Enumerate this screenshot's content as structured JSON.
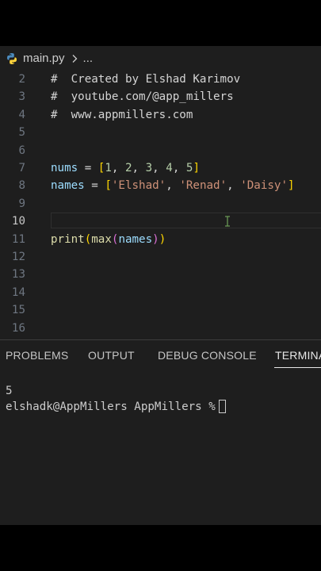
{
  "breadcrumb": {
    "filename": "main.py",
    "more": "..."
  },
  "editor": {
    "line_numbers": [
      "2",
      "3",
      "4",
      "5",
      "6",
      "7",
      "8",
      "9",
      "10",
      "11",
      "12",
      "13",
      "14",
      "15",
      "16"
    ],
    "active_line": "10",
    "lines": {
      "l2": {
        "hash": "#",
        "text": "  Created by Elshad Karimov"
      },
      "l3": {
        "hash": "#",
        "text": "  youtube.com/@app_millers"
      },
      "l4": {
        "hash": "#",
        "text": "  www.appmillers.com"
      },
      "l7": {
        "var": "nums",
        "eq": " = ",
        "open": "[",
        "n1": "1",
        "n2": "2",
        "n3": "3",
        "n4": "4",
        "n5": "5",
        "close": "]",
        "sep": ", "
      },
      "l8": {
        "var": "names",
        "eq": " = ",
        "open": "[",
        "s1": "'Elshad'",
        "s2": "'Renad'",
        "s3": "'Daisy'",
        "close": "]",
        "sep": ", "
      },
      "l11": {
        "print": "print",
        "open1": "(",
        "max": "max",
        "open2": "(",
        "arg": "names",
        "close2": ")",
        "close1": ")"
      }
    }
  },
  "panel": {
    "tabs": [
      "PROBLEMS",
      "OUTPUT",
      "DEBUG CONSOLE",
      "TERMINAL"
    ],
    "active_tab": "TERMINAL",
    "terminal": {
      "output": "5",
      "prompt": "elshadk@AppMillers AppMillers %"
    }
  },
  "colors": {
    "background": "#1e1e1e",
    "comment": "#6a9955",
    "variable": "#9cdcfe",
    "number": "#b5cea8",
    "string": "#ce9178",
    "function": "#dcdcaa",
    "bracket": "#ffd700"
  },
  "icons": {
    "file": "python-icon",
    "separator": "chevron-right-icon",
    "cursor": "ibeam-cursor-icon"
  }
}
